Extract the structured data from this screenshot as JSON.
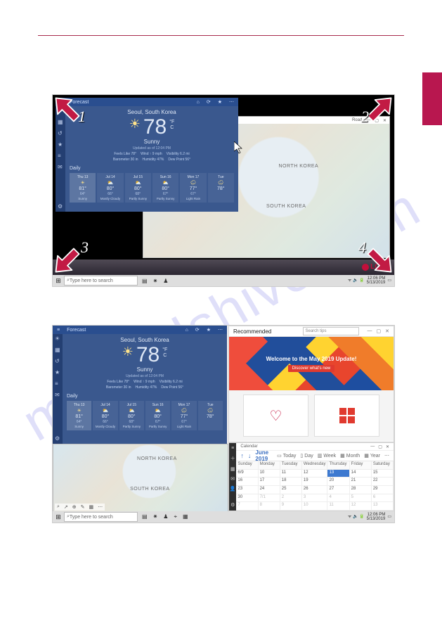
{
  "watermark": "manualshive.com",
  "logo": "LG",
  "corners": [
    "1",
    "2",
    "3",
    "4"
  ],
  "map": {
    "labels": {
      "north": "NORTH KOREA",
      "south": "SOUTH KOREA"
    },
    "toolbar": {
      "road": "Road"
    }
  },
  "taskbar": {
    "search_placeholder": "Type here to search",
    "time": "12:06 PM",
    "date": "5/13/2019"
  },
  "weather": {
    "title": "Forecast",
    "location": "Seoul, South Korea",
    "temp": "78",
    "unit_f": "°F",
    "unit_c": "C",
    "condition": "Sunny",
    "updated": "Updated as of 12:04 PM",
    "meta": {
      "feels": "Feels Like 78°",
      "wind": "Wind ↑ 9 mph",
      "visibility": "Visibility 6.2 mi",
      "barometer": "Barometer 30 in",
      "humidity": "Humidity 47%",
      "dew": "Dew Point 56°"
    },
    "daily_label": "Daily",
    "daily": [
      {
        "d": "Thu 13",
        "ic": "☀",
        "hi": "81°",
        "lo": "64°",
        "c": "Sunny"
      },
      {
        "d": "Jul 14",
        "ic": "⛅",
        "hi": "80°",
        "lo": "66°",
        "c": "Mostly Cloudy"
      },
      {
        "d": "Jul 15",
        "ic": "⛅",
        "hi": "80°",
        "lo": "68°",
        "c": "Partly Sunny"
      },
      {
        "d": "Sun 16",
        "ic": "⛅",
        "hi": "80°",
        "lo": "67°",
        "c": "Partly Sunny"
      },
      {
        "d": "Mon 17",
        "ic": "🌧",
        "hi": "77°",
        "lo": "67°",
        "c": "Light Rain"
      },
      {
        "d": "Tue",
        "ic": "🌧",
        "hi": "78°",
        "lo": "",
        "c": ""
      }
    ]
  },
  "tips": {
    "title": "Recommended",
    "search_placeholder": "Search tips",
    "hero_title": "Welcome to the May 2019 Update!",
    "hero_button": "Discover what's new"
  },
  "calendar": {
    "label": "Calendar",
    "month": "June 2019",
    "views": {
      "today": "Today",
      "day": "Day",
      "week": "Week",
      "month": "Month",
      "year": "Year"
    },
    "dow": [
      "Sunday",
      "Monday",
      "Tuesday",
      "Wednesday",
      "Thursday",
      "Friday",
      "Saturday"
    ],
    "grid": [
      {
        "n": "6/9",
        "m": false
      },
      {
        "n": "10",
        "m": false
      },
      {
        "n": "11",
        "m": false
      },
      {
        "n": "12",
        "m": false
      },
      {
        "n": "13",
        "m": false,
        "today": true
      },
      {
        "n": "14",
        "m": false
      },
      {
        "n": "15",
        "m": false
      },
      {
        "n": "16",
        "m": false
      },
      {
        "n": "17",
        "m": false
      },
      {
        "n": "18",
        "m": false
      },
      {
        "n": "19",
        "m": false
      },
      {
        "n": "20",
        "m": false
      },
      {
        "n": "21",
        "m": false
      },
      {
        "n": "22",
        "m": false
      },
      {
        "n": "23",
        "m": false
      },
      {
        "n": "24",
        "m": false
      },
      {
        "n": "25",
        "m": false
      },
      {
        "n": "26",
        "m": false
      },
      {
        "n": "27",
        "m": false
      },
      {
        "n": "28",
        "m": false
      },
      {
        "n": "29",
        "m": false
      },
      {
        "n": "30",
        "m": false
      },
      {
        "n": "7/1",
        "m": true
      },
      {
        "n": "2",
        "m": true
      },
      {
        "n": "3",
        "m": true
      },
      {
        "n": "4",
        "m": true
      },
      {
        "n": "5",
        "m": true
      },
      {
        "n": "6",
        "m": true
      },
      {
        "n": "7",
        "m": true
      },
      {
        "n": "8",
        "m": true
      },
      {
        "n": "9",
        "m": true
      },
      {
        "n": "10",
        "m": true
      },
      {
        "n": "11",
        "m": true
      },
      {
        "n": "12",
        "m": true
      },
      {
        "n": "13",
        "m": true
      }
    ]
  }
}
